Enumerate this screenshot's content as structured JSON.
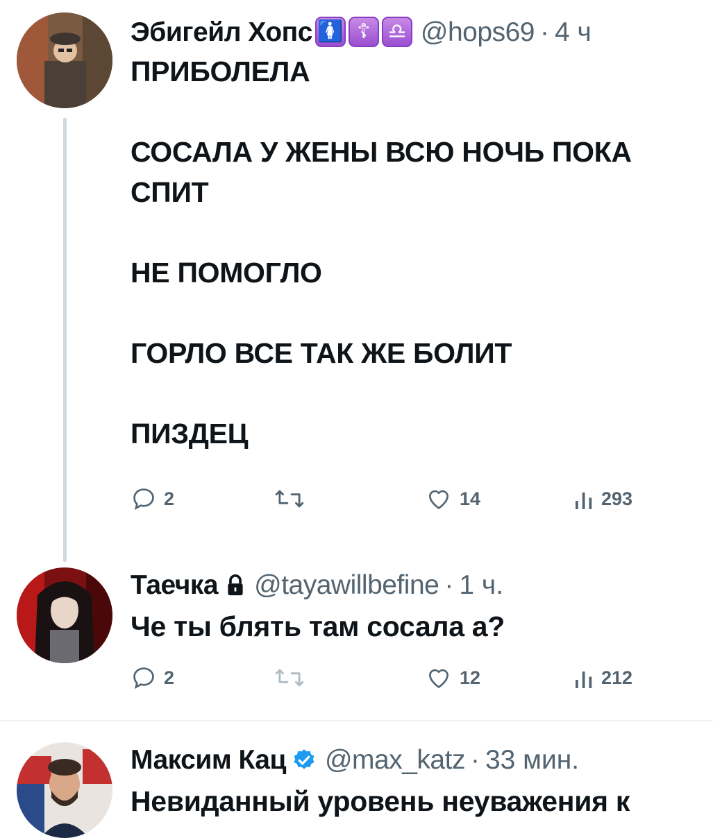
{
  "tweets": [
    {
      "name": "Эбигейл Хопс",
      "badges": [
        "🚺",
        "☦",
        "♎"
      ],
      "handle": "@hops69",
      "dot": "·",
      "time": "4 ч",
      "lines": [
        "ПРИБОЛЕЛА",
        "",
        "СОСАЛА У ЖЕНЫ ВСЮ НОЧЬ ПОКА",
        "СПИТ",
        "",
        "НЕ ПОМОГЛО",
        "",
        "ГОРЛО ВСЕ ТАК ЖЕ БОЛИТ",
        "",
        "ПИЗДЕЦ"
      ],
      "replies": "2",
      "retweets": "",
      "likes": "14",
      "views": "293"
    },
    {
      "name": "Таечка",
      "handle": "@tayawillbefine",
      "dot": "·",
      "time": "1 ч.",
      "lines": [
        "Че ты блять там сосала а?"
      ],
      "replies": "2",
      "retweets": "",
      "likes": "12",
      "views": "212"
    },
    {
      "name": "Максим Кац",
      "handle": "@max_katz",
      "dot": "·",
      "time": "33 мин.",
      "lines": [
        "Невиданный уровень неуважения к"
      ]
    }
  ],
  "colors": {
    "text": "#0f1419",
    "secondary": "#536471",
    "thread_line": "#cfd9de",
    "verified": "#1d9bf0",
    "badge": "#9b4fd1"
  }
}
